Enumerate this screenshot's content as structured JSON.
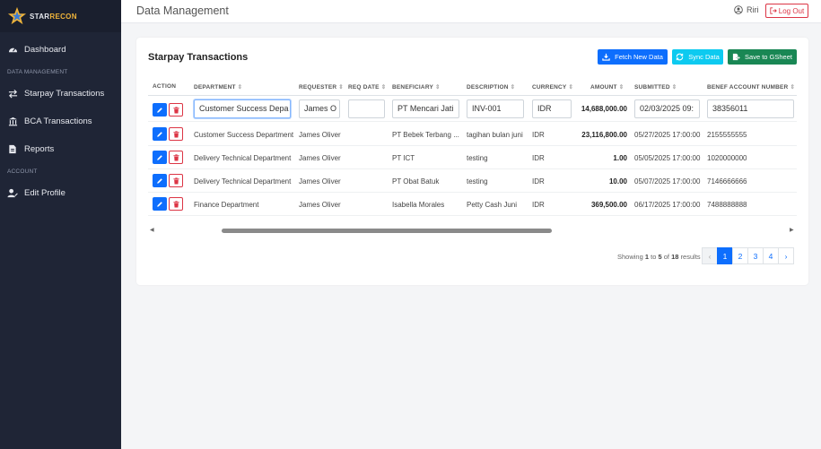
{
  "brand": {
    "part1": "STAR",
    "part2": "RECON"
  },
  "sidebar": {
    "items": [
      {
        "label": "Dashboard"
      },
      {
        "label": "Starpay Transactions"
      },
      {
        "label": "BCA Transactions"
      },
      {
        "label": "Reports"
      },
      {
        "label": "Edit Profile"
      }
    ],
    "sections": {
      "data": "DATA MANAGEMENT",
      "account": "ACCOUNT"
    }
  },
  "header": {
    "title": "Data Management",
    "user": "Riri",
    "logout": "Log Out"
  },
  "card": {
    "title": "Starpay Transactions",
    "fetch_label": "Fetch New Data",
    "sync_label": "Sync Data",
    "save_label": "Save to GSheet"
  },
  "table": {
    "columns": [
      "ACTION",
      "DEPARTMENT",
      "REQUESTER",
      "REQ DATE",
      "BENEFICIARY",
      "DESCRIPTION",
      "CURRENCY",
      "AMOUNT",
      "SUBMITTED",
      "BENEF ACCOUNT NUMBER"
    ],
    "edit_row": {
      "department": "Customer Success Depa",
      "requester": "James O",
      "req_date": "",
      "beneficiary": "PT Mencari Jati",
      "description": "INV-001",
      "currency": "IDR",
      "amount": "14,688,000.00",
      "submitted": "02/03/2025 09:",
      "account": "38356011"
    },
    "rows": [
      {
        "department": "Customer Success Department",
        "requester": "James Oliver",
        "req_date": "",
        "beneficiary": "PT Bebek Terbang ...",
        "description": "tagihan bulan juni",
        "currency": "IDR",
        "amount": "23,116,800.00",
        "submitted": "05/27/2025 17:00:00",
        "account": "2155555555"
      },
      {
        "department": "Delivery Technical Department",
        "requester": "James Oliver",
        "req_date": "",
        "beneficiary": "PT ICT",
        "description": "testing",
        "currency": "IDR",
        "amount": "1.00",
        "submitted": "05/05/2025 17:00:00",
        "account": "1020000000"
      },
      {
        "department": "Delivery Technical Department",
        "requester": "James Oliver",
        "req_date": "",
        "beneficiary": "PT Obat Batuk",
        "description": "testing",
        "currency": "IDR",
        "amount": "10.00",
        "submitted": "05/07/2025 17:00:00",
        "account": "7146666666"
      },
      {
        "department": "Finance Department",
        "requester": "James Oliver",
        "req_date": "",
        "beneficiary": "Isabella Morales",
        "description": "Petty Cash Juni",
        "currency": "IDR",
        "amount": "369,500.00",
        "submitted": "06/17/2025 17:00:00",
        "account": "7488888888"
      }
    ]
  },
  "pagination": {
    "showing_prefix": "Showing",
    "from": "1",
    "to_word": "to",
    "to": "5",
    "of_word": "of",
    "total": "18",
    "suffix": "results",
    "prev": "‹",
    "next": "›",
    "pages": [
      "1",
      "2",
      "3",
      "4"
    ]
  },
  "colors": {
    "sidebar": "#1f2536",
    "primary": "#0d6efd",
    "info": "#0dcaf0",
    "success": "#198754",
    "danger": "#dc3545"
  }
}
